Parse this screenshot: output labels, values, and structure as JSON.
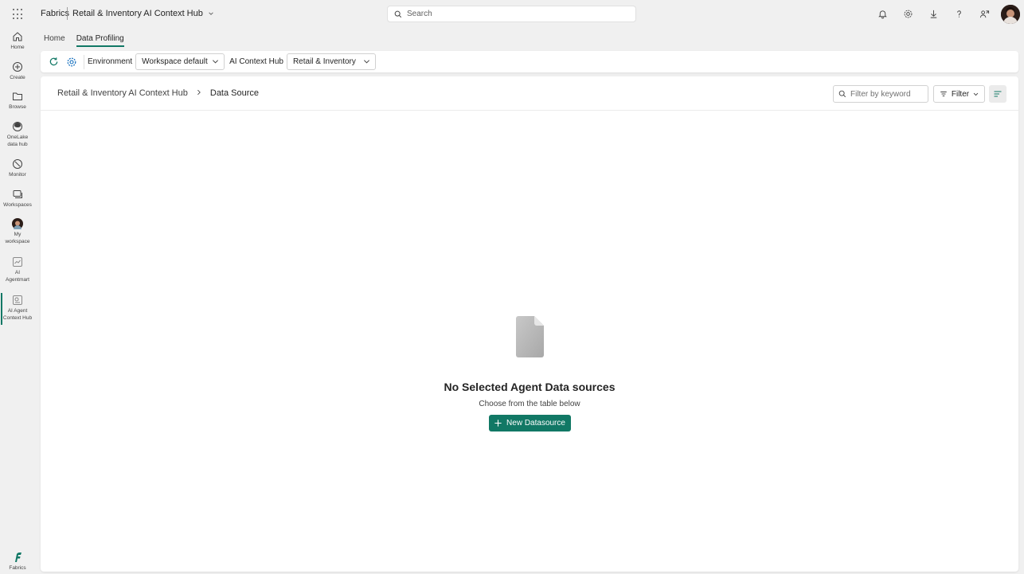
{
  "topbar": {
    "brand": "Fabrics",
    "hub_name": "Retail & Inventory AI Context Hub",
    "search_placeholder": "Search",
    "icons": [
      "bell-icon",
      "gear-icon",
      "download-icon",
      "help-icon",
      "share-icon"
    ]
  },
  "rail": {
    "items": [
      {
        "label": "Home",
        "icon": "home-icon"
      },
      {
        "label": "Create",
        "icon": "plus-circle-icon"
      },
      {
        "label": "Browse",
        "icon": "folder-icon"
      },
      {
        "label": "OneLake data hub",
        "icon": "onelake-icon"
      },
      {
        "label": "Monitor",
        "icon": "monitor-icon"
      },
      {
        "label": "Workspaces",
        "icon": "workspaces-icon"
      },
      {
        "label": "My workspace",
        "icon": "avatar"
      },
      {
        "label": "AI Agentmart",
        "icon": "agentmart-icon"
      },
      {
        "label": "AI Agent Context Hub",
        "icon": "context-hub-icon"
      }
    ],
    "active_index": 8,
    "footer_label": "Fabrics"
  },
  "tabs": [
    {
      "label": "Home",
      "active": false
    },
    {
      "label": "Data Profiling",
      "active": true
    }
  ],
  "toolbar": {
    "environment_label": "Environment",
    "environment_value": "Workspace default",
    "hub_label": "AI Context Hub",
    "hub_value": "Retail & Inventory"
  },
  "breadcrumb": {
    "parent": "Retail & Inventory AI Context Hub",
    "current": "Data Source"
  },
  "filter": {
    "placeholder": "Filter by keyword",
    "button_label": "Filter"
  },
  "empty_state": {
    "title": "No Selected Agent Data sources",
    "subtitle": "Choose from the table below",
    "button_label": "New Datasource"
  },
  "colors": {
    "accent": "#117865",
    "background": "#f0f0f0",
    "panel": "#ffffff"
  }
}
